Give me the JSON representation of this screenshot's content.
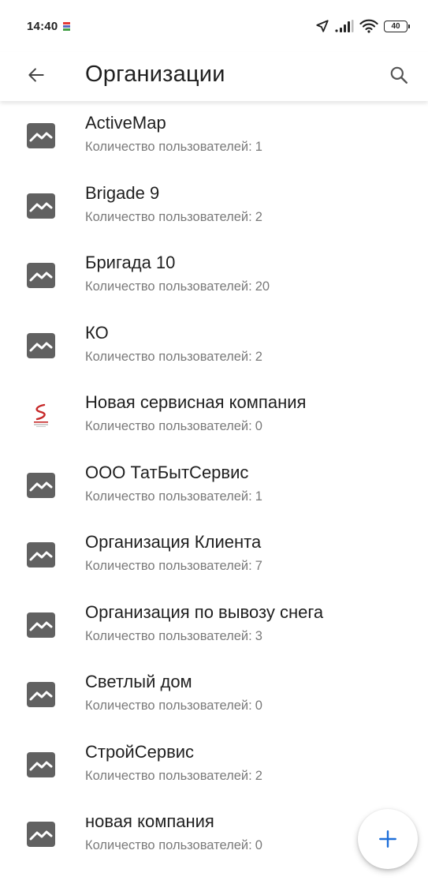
{
  "status_bar": {
    "time": "14:40",
    "battery_level": "40",
    "icons": [
      "notification-icon",
      "location-arrow-icon",
      "signal-icon",
      "wifi-icon",
      "battery-icon"
    ]
  },
  "app_bar": {
    "title": "Организации",
    "back_icon": "arrow-back-icon",
    "search_icon": "search-icon"
  },
  "users_label": "Количество пользователей:",
  "organizations": [
    {
      "name": "ActiveMap",
      "users": "1",
      "logo": "image-placeholder-icon"
    },
    {
      "name": "Brigade 9",
      "users": "2",
      "logo": "image-placeholder-icon"
    },
    {
      "name": "Бригада 10",
      "users": "20",
      "logo": "image-placeholder-icon"
    },
    {
      "name": "КО",
      "users": "2",
      "logo": "image-placeholder-icon"
    },
    {
      "name": "Новая сервисная компания",
      "users": "0",
      "logo": "company-logo-icon"
    },
    {
      "name": "ООО ТатБытСервис",
      "users": "1",
      "logo": "image-placeholder-icon"
    },
    {
      "name": "Организация Клиента",
      "users": "7",
      "logo": "image-placeholder-icon"
    },
    {
      "name": "Организация по вывозу снега",
      "users": "3",
      "logo": "image-placeholder-icon"
    },
    {
      "name": "Светлый дом",
      "users": "0",
      "logo": "image-placeholder-icon"
    },
    {
      "name": "СтройСервис",
      "users": "2",
      "logo": "image-placeholder-icon"
    },
    {
      "name": "новая компания",
      "users": "0",
      "logo": "image-placeholder-icon"
    }
  ],
  "fab": {
    "icon": "plus-icon"
  },
  "colors": {
    "accent": "#1e6fd9",
    "icon_gray": "#616161",
    "secondary_text": "#7a7a7a",
    "logo_red": "#c62828"
  }
}
